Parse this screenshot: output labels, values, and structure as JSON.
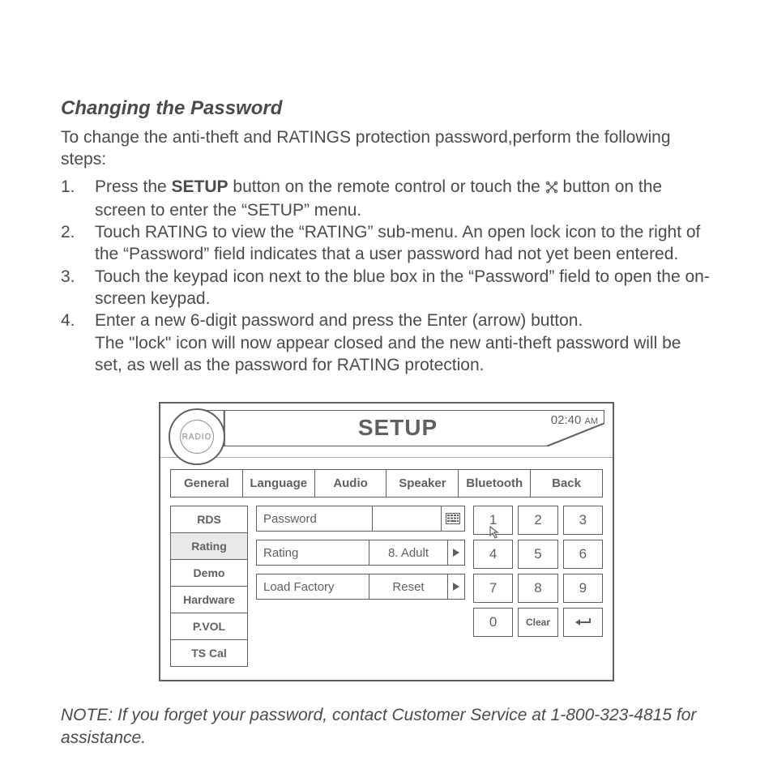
{
  "heading": "Changing the Password",
  "intro": "To change the anti-theft and RATINGS protection password,perform the following steps:",
  "steps": [
    {
      "num": "1.",
      "pre": "Press the ",
      "bold": "SETUP",
      "mid": " button on the remote control or touch the ",
      "post": " button on the screen to enter the “SETUP” menu."
    },
    {
      "num": "2.",
      "text": "Touch RATING to view the “RATING” sub-menu. An open lock icon to the right of the “Password” field indicates that a user password had not yet been entered."
    },
    {
      "num": "3.",
      "text": "Touch the keypad icon next to the blue box in the “Password” field to open the on-screen keypad."
    },
    {
      "num": "4.",
      "text": "Enter a new 6-digit password and press the Enter (arrow) button.\nThe \"lock\" icon will now appear closed and the new anti-theft password will be set, as well as the password for RATING protection."
    }
  ],
  "note": "NOTE: If you forget your password, contact Customer Service at 1-800-323-4815 for assistance.",
  "screen": {
    "badge": "RADIO",
    "title": "SETUP",
    "clock": {
      "time": "02:40",
      "ampm": "AM"
    },
    "topnav": [
      "General",
      "Language",
      "Audio",
      "Speaker",
      "Bluetooth",
      "Back"
    ],
    "sidenav": [
      "RDS",
      "Rating",
      "Demo",
      "Hardware",
      "P.VOL",
      "TS Cal"
    ],
    "sidenav_selected": "Rating",
    "rows": {
      "password_label": "Password",
      "password_value": "",
      "rating_label": "Rating",
      "rating_value": "8. Adult",
      "factory_label": "Load Factory",
      "factory_value": "Reset"
    },
    "keys": [
      [
        "1",
        "2",
        "3"
      ],
      [
        "4",
        "5",
        "6"
      ],
      [
        "7",
        "8",
        "9"
      ],
      [
        "0",
        "Clear",
        "enter"
      ]
    ]
  }
}
